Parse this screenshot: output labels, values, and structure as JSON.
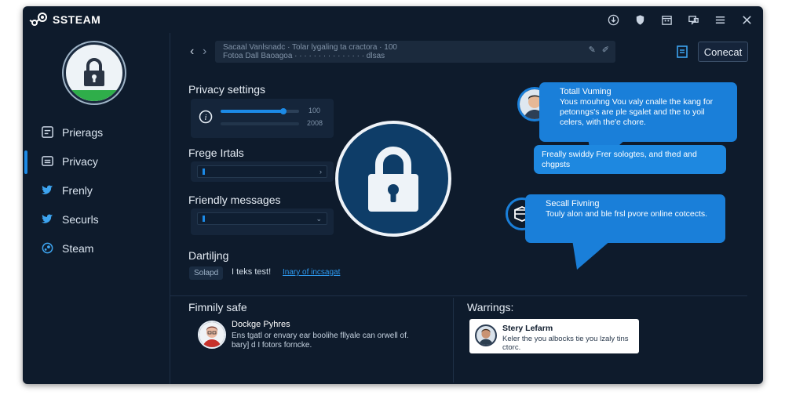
{
  "app": {
    "title": "SSTEAM"
  },
  "window_controls": [
    "download-icon",
    "shield-icon",
    "calendar-icon",
    "chat-icon",
    "menu-icon",
    "close-icon"
  ],
  "sidebar": {
    "items": [
      {
        "label": "Prierags",
        "icon": "settings-icon",
        "active": false
      },
      {
        "label": "Privacy",
        "icon": "privacy-icon",
        "active": true
      },
      {
        "label": "Frenly",
        "icon": "bird-icon",
        "active": false
      },
      {
        "label": "Securls",
        "icon": "bird-icon",
        "active": false
      },
      {
        "label": "Steam",
        "icon": "steam-icon",
        "active": false
      }
    ]
  },
  "search": {
    "line1": "Sacaal Vanlsnadc ·  Tolar lygaling ta cractora · 100",
    "line2": "Fotoa Dall Baoagoa · · · · · · · · · · · ·  · · · dlsas"
  },
  "header": {
    "connect_label": "Conecat"
  },
  "privacy": {
    "title": "Privacy settings",
    "slider_value_1": "100",
    "slider_value_2": "2008",
    "slider_level": 0.8,
    "free_title": "Frege Irtals",
    "friendly_title": "Friendly messages",
    "dartjing_title": "Dartiljng",
    "chip_label": "Solapd",
    "inline_text": "I teks test!",
    "link_text": "Inary of incsagat"
  },
  "bubbles": {
    "one": {
      "title": "Totall Vuming",
      "text": "Yous mouhng Vou valy cnalle the kang for petonngs's are ple sgalet and the to yoil celers, with the'e chore."
    },
    "two": {
      "text": "Freally swiddy   Frer sologtes, and thed and chgpsts"
    },
    "three": {
      "title": "Secall Fivning",
      "text": "Touly alon and ble frsl pvore online cotcects."
    }
  },
  "bottom": {
    "left_title": "Fimnily safe",
    "left_person": "Dockge Pyhres",
    "left_text": "Ens tgatl or envary ear boolihe fllyale can orwell of. bary] d I fotors forncke.",
    "right_title": "Warrings:",
    "right_person": "Stery Lefarm",
    "right_text": "Keler the you albocks tie you lzaly tins ctorc."
  },
  "colors": {
    "background": "#0e1b2c",
    "accent": "#1c8ae6",
    "bubble": "#1a7fd9",
    "lock_circle": "#0e3d68",
    "green": "#2fae4a"
  }
}
